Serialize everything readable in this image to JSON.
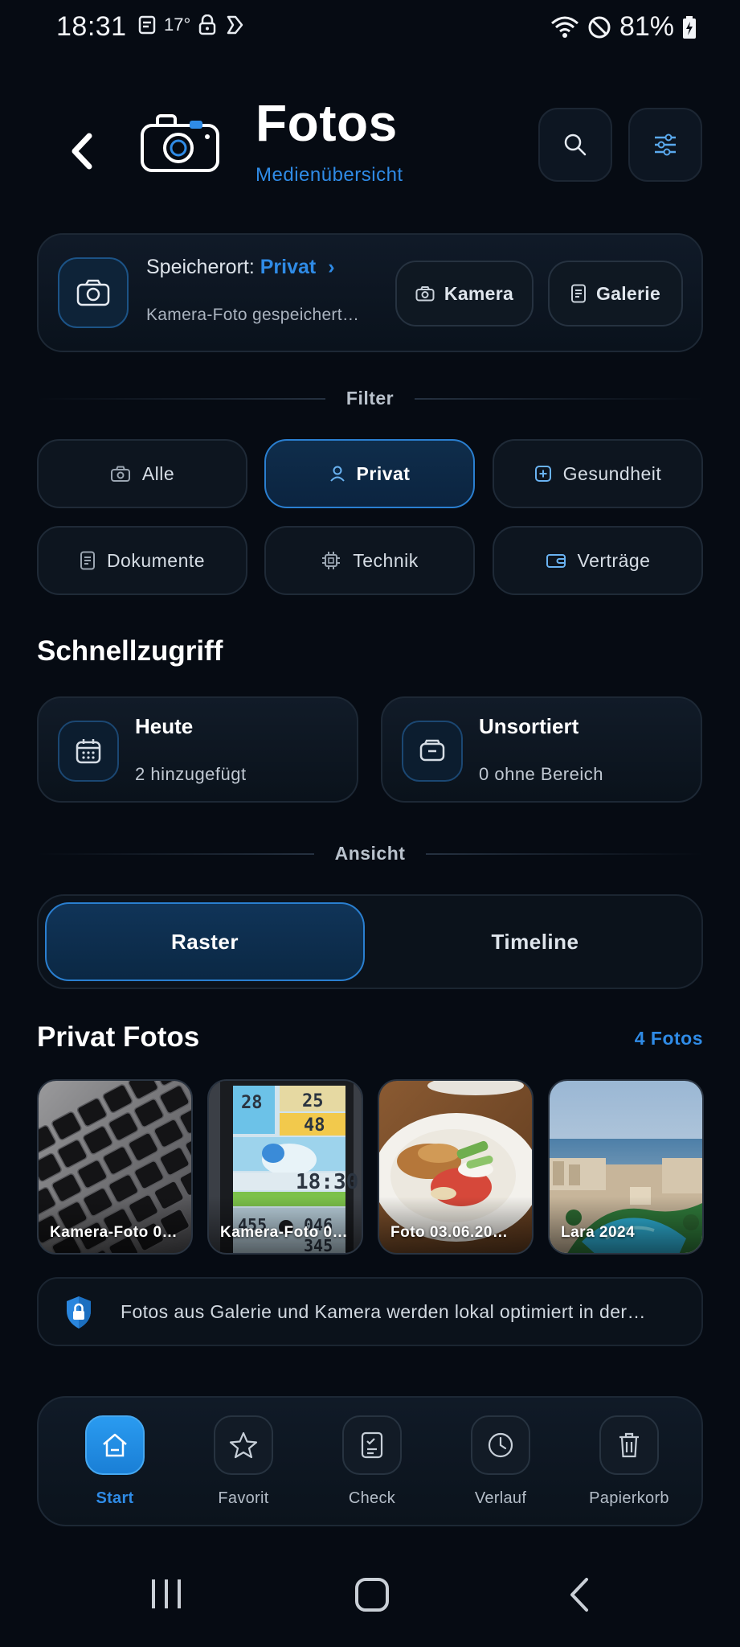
{
  "status_bar": {
    "time": "18:31",
    "temperature": "17°",
    "battery": "81%"
  },
  "header": {
    "title": "Fotos",
    "subtitle": "Medienübersicht"
  },
  "storage": {
    "label": "Speicherort:",
    "location": "Privat",
    "chevron": "›",
    "description": "Kamera-Foto gespeichert…",
    "camera_button": "Kamera",
    "gallery_button": "Galerie"
  },
  "filter": {
    "section_label": "Filter",
    "chips": [
      {
        "label": "Alle",
        "icon": "camera-icon",
        "active": false
      },
      {
        "label": "Privat",
        "icon": "person-icon",
        "active": true
      },
      {
        "label": "Gesundheit",
        "icon": "health-plus-icon",
        "active": false
      },
      {
        "label": "Dokumente",
        "icon": "document-icon",
        "active": false
      },
      {
        "label": "Technik",
        "icon": "chip-icon",
        "active": false
      },
      {
        "label": "Verträge",
        "icon": "wallet-icon",
        "active": false
      }
    ]
  },
  "quick_access": {
    "heading": "Schnellzugriff",
    "cards": [
      {
        "title": "Heute",
        "subtitle": "2 hinzugefügt",
        "icon": "calendar-icon"
      },
      {
        "title": "Unsortiert",
        "subtitle": "0 ohne Bereich",
        "icon": "inbox-icon"
      }
    ]
  },
  "view": {
    "section_label": "Ansicht",
    "options": [
      "Raster",
      "Timeline"
    ],
    "selected": "Raster"
  },
  "photos": {
    "heading": "Privat Fotos",
    "count": "4 Fotos",
    "items": [
      {
        "caption": "Kamera-Foto 0…"
      },
      {
        "caption": "Kamera-Foto 0…"
      },
      {
        "caption": "Foto 03.06.20…"
      },
      {
        "caption": "Lara  2024"
      }
    ]
  },
  "info": {
    "text": "Fotos aus Galerie und Kamera werden lokal optimiert in der…",
    "icon": "shield-lock-icon"
  },
  "bottom_nav": {
    "items": [
      {
        "label": "Start",
        "icon": "home-icon",
        "active": true
      },
      {
        "label": "Favorit",
        "icon": "star-icon",
        "active": false
      },
      {
        "label": "Check",
        "icon": "checklist-icon",
        "active": false
      },
      {
        "label": "Verlauf",
        "icon": "clock-icon",
        "active": false
      },
      {
        "label": "Papierkorb",
        "icon": "trash-icon",
        "active": false
      }
    ]
  },
  "colors": {
    "background": "#060b13",
    "accent": "#2f8be6",
    "active_border": "#2a7fd0"
  }
}
